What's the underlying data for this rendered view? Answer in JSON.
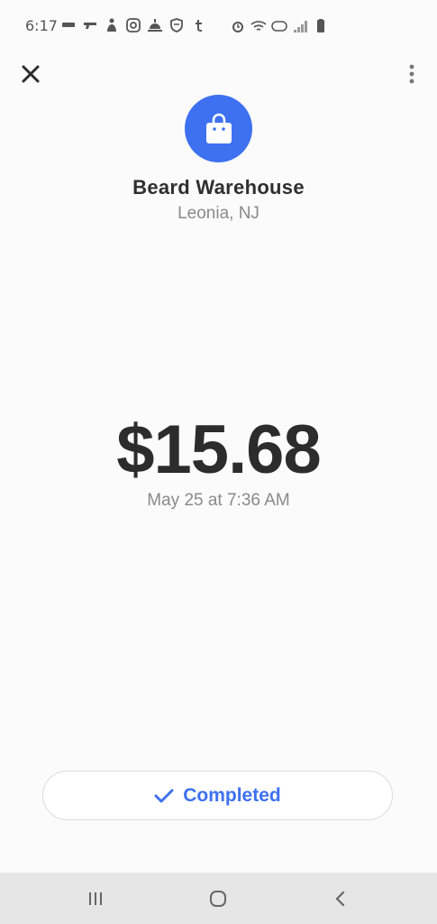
{
  "status_bar": {
    "time": "6:17",
    "left_icons": [
      "message-icon",
      "gun-icon",
      "figure-icon",
      "instagram-icon",
      "sunrise-icon",
      "shield-icon",
      "tumblr-icon"
    ],
    "right_icons": [
      "alarm-icon",
      "wifi-icon",
      "volte-icon",
      "signal-icon",
      "battery-icon"
    ]
  },
  "merchant": {
    "icon": "shopping-bag-icon",
    "name": "Beard Warehouse",
    "location": "Leonia, NJ"
  },
  "transaction": {
    "amount": "$15.68",
    "date": "May 25 at 7:36 AM"
  },
  "status_pill": {
    "icon": "checkmark-icon",
    "label": "Completed"
  },
  "colors": {
    "accent": "#3d71f0",
    "background": "#fbfbfb",
    "nav_bar": "#e6e6e6"
  },
  "nav_bar": {
    "items": [
      "recents-icon",
      "home-icon",
      "back-icon"
    ]
  }
}
